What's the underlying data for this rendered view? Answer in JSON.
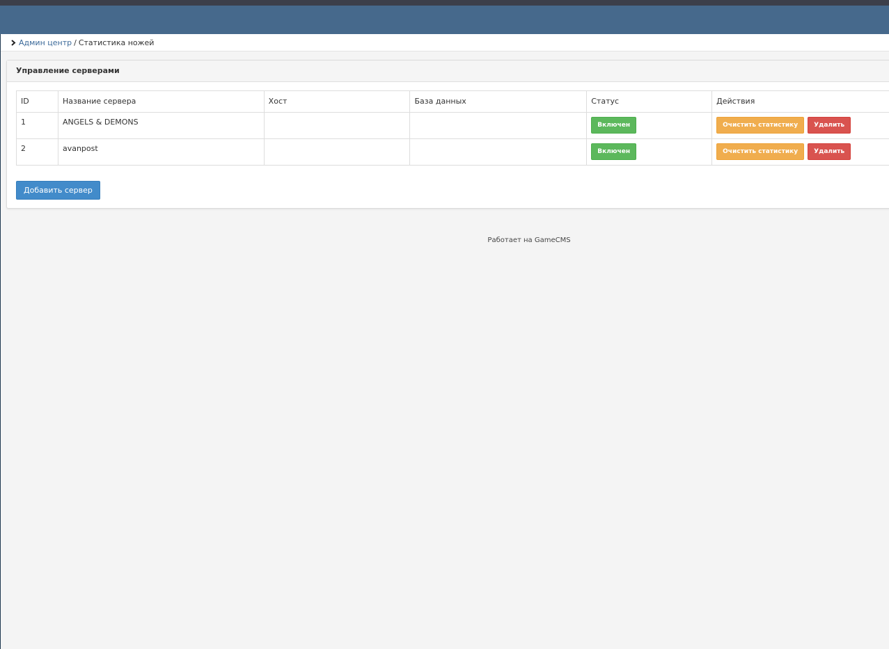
{
  "breadcrumb": {
    "root_label": "Админ центр",
    "separator": "/",
    "current_label": "Статистика ножей"
  },
  "panel": {
    "title": "Управление серверами"
  },
  "table": {
    "headers": [
      "ID",
      "Название сервера",
      "Хост",
      "База данных",
      "Статус",
      "Действия"
    ],
    "rows": [
      {
        "id": "1",
        "name": "ANGELS & DEMONS",
        "host": "",
        "database": "",
        "status": "Включен"
      },
      {
        "id": "2",
        "name": "avanpost",
        "host": "",
        "database": "",
        "status": "Включен"
      }
    ],
    "clear_stats_label": "Очистить статистику",
    "delete_label": "Удалить"
  },
  "add_server_label": "Добавить сервер",
  "footer_text": "Работает на GameCMS",
  "colors": {
    "header": "#46698c",
    "success": "#5cb85c",
    "warning": "#f0ad4e",
    "danger": "#d9534f",
    "primary": "#428bca"
  },
  "icons": {
    "breadcrumb": "chevron-right-icon"
  }
}
